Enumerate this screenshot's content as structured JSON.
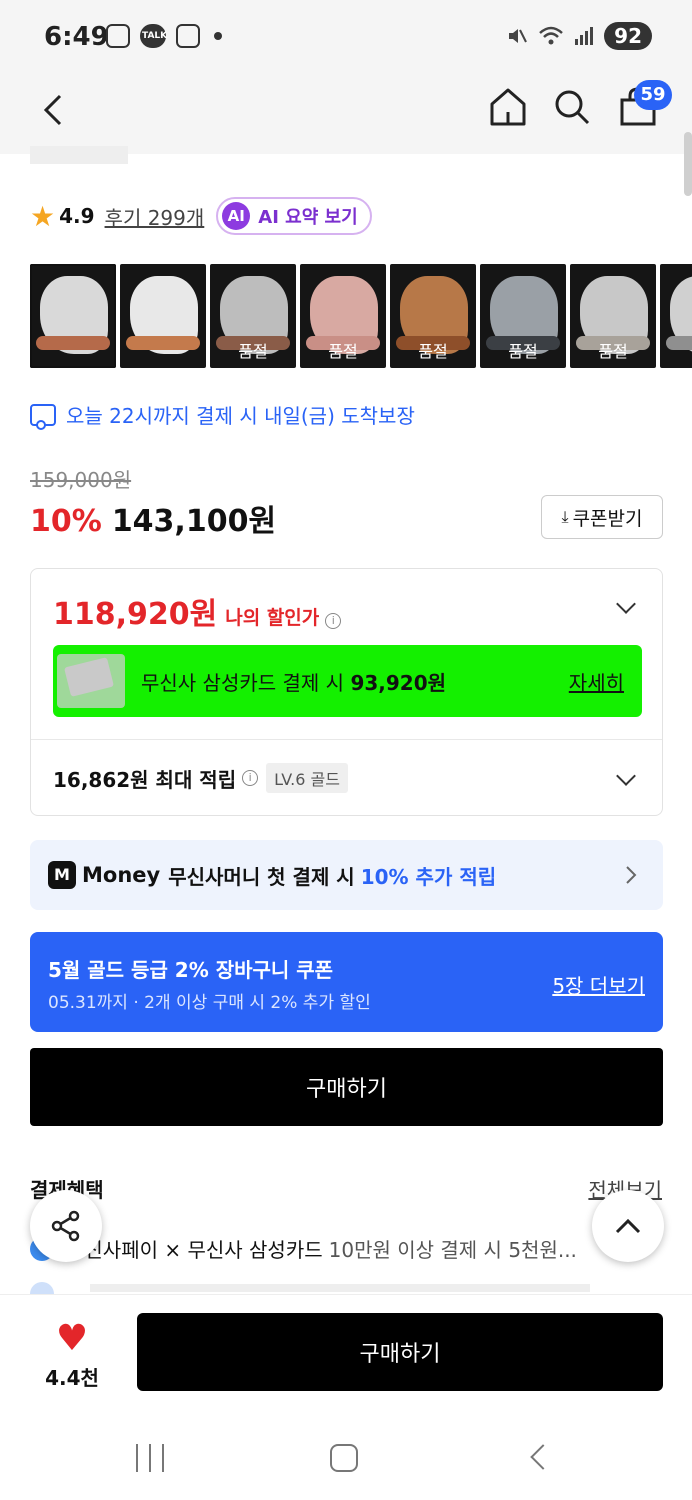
{
  "status_bar": {
    "time": "6:49",
    "battery": "92",
    "talk_label": "TALK"
  },
  "header": {
    "cart_count": "59"
  },
  "product": {
    "rating": "4.9",
    "review_link": "후기 299개",
    "ai_badge": "AI",
    "ai_summary": "AI 요약 보기",
    "thumbnails": [
      {
        "label": "",
        "colors": [
          "#d9d9d9",
          "#b56a4a"
        ],
        "selected": true
      },
      {
        "label": "",
        "colors": [
          "#e8e8e8",
          "#c47a4c"
        ],
        "selected": false
      },
      {
        "label": "품절",
        "colors": [
          "#bdbdbd",
          "#8a5c48"
        ],
        "selected": false
      },
      {
        "label": "품절",
        "colors": [
          "#d8a9a2",
          "#c98f86"
        ],
        "selected": false
      },
      {
        "label": "품절",
        "colors": [
          "#b77848",
          "#8e4f2a"
        ],
        "selected": false
      },
      {
        "label": "품절",
        "colors": [
          "#9aa0a6",
          "#3b3f44"
        ],
        "selected": false
      },
      {
        "label": "품절",
        "colors": [
          "#c8c8c8",
          "#a8a29a"
        ],
        "selected": false
      },
      {
        "label": "품",
        "colors": [
          "#d0d0d0",
          "#8f8f8f"
        ],
        "selected": false
      }
    ],
    "delivery": "오늘 22시까지 결제 시 내일(금) 도착보장",
    "original_price": "159,000원",
    "discount_rate": "10%",
    "sale_price": "143,100원",
    "coupon_button": "쿠폰받기"
  },
  "my_price": {
    "price": "118,920원",
    "label": "나의 할인가",
    "card_text": "무신사 삼성카드 결제 시",
    "card_price": "93,920원",
    "card_detail": "자세히",
    "points": "16,862원 최대 적립",
    "level": "LV.6 골드"
  },
  "money_banner": {
    "logo": "M",
    "brand": "Money",
    "text": "무신사머니 첫 결제 시",
    "accent": "10% 추가 적립"
  },
  "coupon_banner": {
    "title": "5월 골드 등급 2% 장바구니 쿠폰",
    "subtitle": "05.31까지 · 2개 이상 구매 시 2% 추가 할인",
    "more": "5장 더보기"
  },
  "buy_label": "구매하기",
  "benefits": {
    "title": "결제혜택",
    "all": "전체보기",
    "line1": "무신사페이 × 무신사 삼성카드",
    "line1_muted": "10만원 이상 결제 시 5천원..."
  },
  "bottom_bar": {
    "like_count": "4.4천",
    "buy_label": "구매하기"
  },
  "colors": {
    "accent_blue": "#2a63f6",
    "sale_red": "#e3262a",
    "card_green": "#14f000"
  }
}
